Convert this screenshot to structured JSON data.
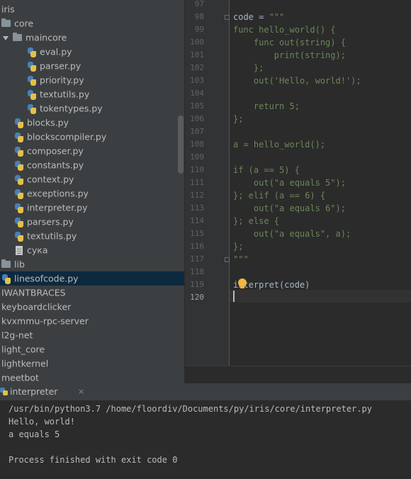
{
  "project_tree": {
    "items": [
      {
        "label": "iris",
        "icon": "none"
      },
      {
        "label": "core",
        "icon": "folder-icon"
      },
      {
        "label": "maincore",
        "icon": "folder-icon",
        "expanded": true
      },
      {
        "label": "eval.py",
        "icon": "python-file-icon"
      },
      {
        "label": "parser.py",
        "icon": "python-file-icon"
      },
      {
        "label": "priority.py",
        "icon": "python-file-icon"
      },
      {
        "label": "textutils.py",
        "icon": "python-file-icon"
      },
      {
        "label": "tokentypes.py",
        "icon": "python-file-icon"
      },
      {
        "label": "blocks.py",
        "icon": "python-file-icon"
      },
      {
        "label": "blockscompiler.py",
        "icon": "python-file-icon"
      },
      {
        "label": "composer.py",
        "icon": "python-file-icon"
      },
      {
        "label": "constants.py",
        "icon": "python-file-icon"
      },
      {
        "label": "context.py",
        "icon": "python-file-icon"
      },
      {
        "label": "exceptions.py",
        "icon": "python-file-icon"
      },
      {
        "label": "interpreter.py",
        "icon": "python-file-icon"
      },
      {
        "label": "parsers.py",
        "icon": "python-file-icon"
      },
      {
        "label": "textutils.py",
        "icon": "python-file-icon"
      },
      {
        "label": "сука",
        "icon": "text-file-icon"
      },
      {
        "label": "lib",
        "icon": "folder-icon"
      },
      {
        "label": "linesofcode.py",
        "icon": "python-file-icon",
        "selected": true
      },
      {
        "label": "IWANTBRACES",
        "icon": "none"
      },
      {
        "label": "keyboardclicker",
        "icon": "none"
      },
      {
        "label": "kvxmmu-rpc-server",
        "icon": "none"
      },
      {
        "label": "l2g-net",
        "icon": "none"
      },
      {
        "label": "light_core",
        "icon": "none"
      },
      {
        "label": "lightkernel",
        "icon": "none"
      },
      {
        "label": "meetbot",
        "icon": "none"
      }
    ]
  },
  "editor": {
    "current_line": "120",
    "lines": [
      {
        "num": "97",
        "text": ""
      },
      {
        "num": "98",
        "text": "code = \"\"\""
      },
      {
        "num": "99",
        "text": "func hello_world() {"
      },
      {
        "num": "100",
        "text": "    func out(string) {"
      },
      {
        "num": "101",
        "text": "        print(string);"
      },
      {
        "num": "102",
        "text": "    };"
      },
      {
        "num": "103",
        "text": "    out('Hello, world!');"
      },
      {
        "num": "104",
        "text": ""
      },
      {
        "num": "105",
        "text": "    return 5;"
      },
      {
        "num": "106",
        "text": "};"
      },
      {
        "num": "107",
        "text": ""
      },
      {
        "num": "108",
        "text": "a = hello_world();"
      },
      {
        "num": "109",
        "text": ""
      },
      {
        "num": "110",
        "text": "if (a == 5) {"
      },
      {
        "num": "111",
        "text": "    out(\"a equals 5\");"
      },
      {
        "num": "112",
        "text": "}; elif (a == 6) {"
      },
      {
        "num": "113",
        "text": "    out(\"a equals 6\");"
      },
      {
        "num": "114",
        "text": "}; else {"
      },
      {
        "num": "115",
        "text": "    out(\"a equals\", a);"
      },
      {
        "num": "116",
        "text": "};"
      },
      {
        "num": "117",
        "text": "\"\"\""
      },
      {
        "num": "118",
        "text": ""
      },
      {
        "num": "119",
        "text": "interpret(code)"
      },
      {
        "num": "120",
        "text": ""
      }
    ]
  },
  "run_panel": {
    "tab_label": "interpreter",
    "close_glyph": "×",
    "output": [
      "/usr/bin/python3.7 /home/floordiv/Documents/py/iris/core/interpreter.py",
      "Hello, world!",
      "a equals 5",
      "",
      "Process finished with exit code 0"
    ]
  },
  "colors": {
    "string": "#6a8759",
    "default_code": "#a9b7c6",
    "tree_background": "#3c3f41",
    "editor_background": "#2b2b2b",
    "selection": "#0d293e"
  }
}
